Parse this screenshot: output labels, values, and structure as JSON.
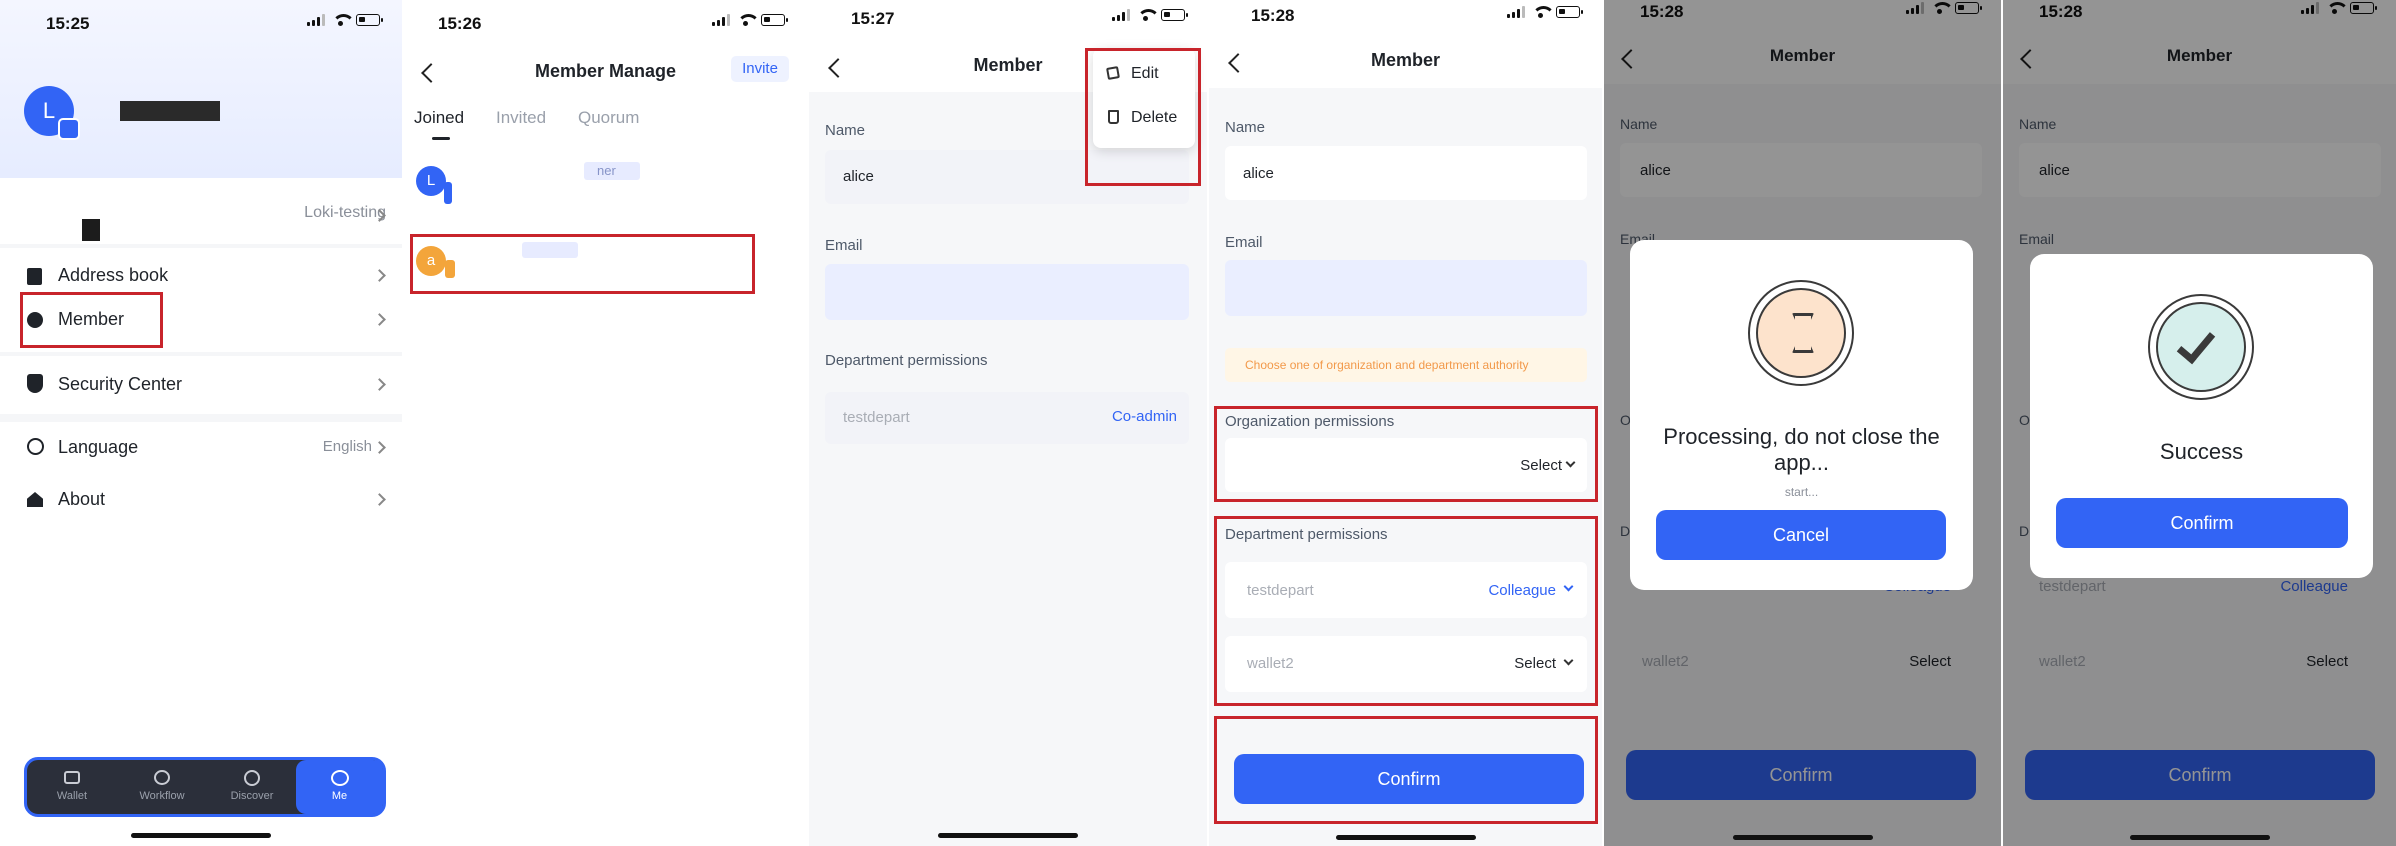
{
  "colors": {
    "accent": "#3264f5",
    "highlight": "#c8242b",
    "warning_bg": "#fff6e6",
    "warning_text": "#f2994a",
    "avatar_orange": "#f3a53b"
  },
  "phone1": {
    "time": "15:25",
    "avatar_letter": "L",
    "org_name": "Loki-testing",
    "menu": [
      {
        "label": "Address book",
        "icon": "address-book-icon"
      },
      {
        "label": "Member",
        "icon": "member-icon"
      },
      {
        "label": "Security Center",
        "icon": "shield-icon"
      },
      {
        "label": "Language",
        "icon": "globe-icon",
        "value": "English"
      },
      {
        "label": "About",
        "icon": "home-icon"
      }
    ],
    "tabbar": [
      {
        "label": "Wallet",
        "icon": "wallet-icon"
      },
      {
        "label": "Workflow",
        "icon": "workflow-icon"
      },
      {
        "label": "Discover",
        "icon": "compass-icon"
      },
      {
        "label": "Me",
        "icon": "me-icon"
      }
    ]
  },
  "phone2": {
    "time": "15:26",
    "title": "Member Manage",
    "invite": "Invite",
    "tabs": [
      "Joined",
      "Invited",
      "Quorum"
    ],
    "members": [
      {
        "letter": "L",
        "role": "ner"
      },
      {
        "letter": "a"
      }
    ]
  },
  "phone3": {
    "time": "15:27",
    "title": "Member",
    "menu": {
      "edit": "Edit",
      "delete": "Delete"
    },
    "name_label": "Name",
    "name_value": "alice",
    "email_label": "Email",
    "dept_label": "Department permissions",
    "dept_name": "testdepart",
    "dept_role": "Co-admin"
  },
  "phone4": {
    "time": "15:28",
    "title": "Member",
    "name_label": "Name",
    "name_value": "alice",
    "email_label": "Email",
    "warning": "Choose one of organization and department authority",
    "org_label": "Organization permissions",
    "org_select": "Select",
    "dept_label": "Department permissions",
    "depts": [
      {
        "name": "testdepart",
        "role": "Colleague"
      },
      {
        "name": "wallet2",
        "role": "Select"
      }
    ],
    "confirm": "Confirm"
  },
  "phone5": {
    "time": "15:28",
    "title": "Member",
    "name_label": "Name",
    "name_value": "alice",
    "email_label": "Email",
    "dept_label_partial": "D",
    "org_label_partial": "O",
    "dept_role": "Colleague",
    "wallet2": "wallet2",
    "wallet2_select": "Select",
    "modal_title": "Processing, do not close the app...",
    "modal_sub": "start...",
    "cancel": "Cancel",
    "confirm": "Confirm"
  },
  "phone6": {
    "time": "15:28",
    "title": "Member",
    "name_label": "Name",
    "name_value": "alice",
    "email_label": "Email",
    "dept_label_partial": "D",
    "org_label_partial": "O",
    "dept_name": "testdepart",
    "dept_role": "Colleague",
    "wallet2": "wallet2",
    "wallet2_select": "Select",
    "modal_title": "Success",
    "modal_confirm": "Confirm",
    "confirm": "Confirm"
  }
}
